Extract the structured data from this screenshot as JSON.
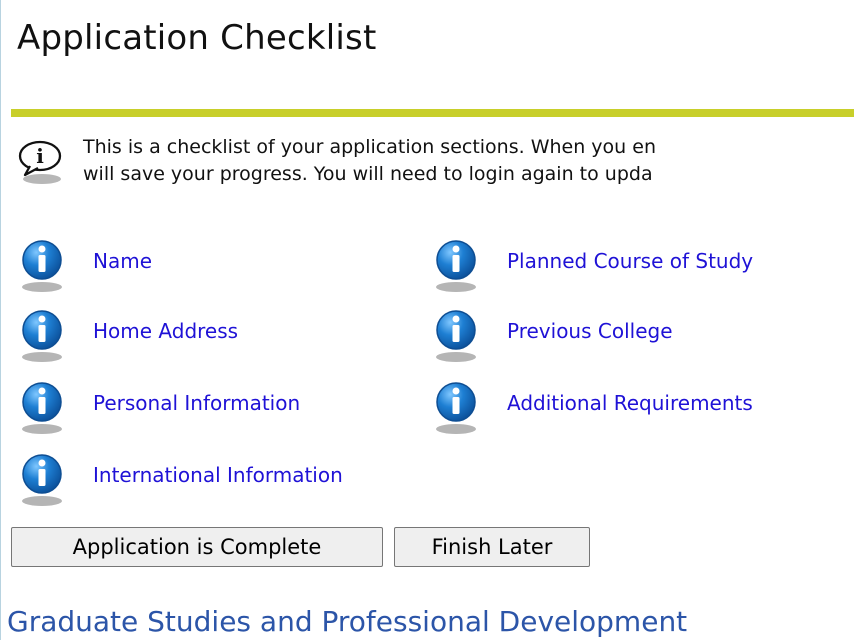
{
  "page": {
    "title": "Application Checklist",
    "info_line_1": "This is a checklist of your application sections. When you en",
    "info_line_2": "will save your progress. You will need to login again to upda"
  },
  "checklist": {
    "left_column": [
      {
        "label": "Name"
      },
      {
        "label": "Home Address"
      },
      {
        "label": "Personal Information"
      },
      {
        "label": "International Information"
      }
    ],
    "right_column": [
      {
        "label": "Planned Course of Study"
      },
      {
        "label": "Previous College"
      },
      {
        "label": "Additional Requirements"
      }
    ]
  },
  "actions": {
    "complete_label": "Application is Complete",
    "finish_later_label": "Finish Later"
  },
  "footer": {
    "heading": "Graduate Studies and Professional Development"
  },
  "icons": {
    "speech": "speech-bubble-icon",
    "info": "info-icon"
  }
}
